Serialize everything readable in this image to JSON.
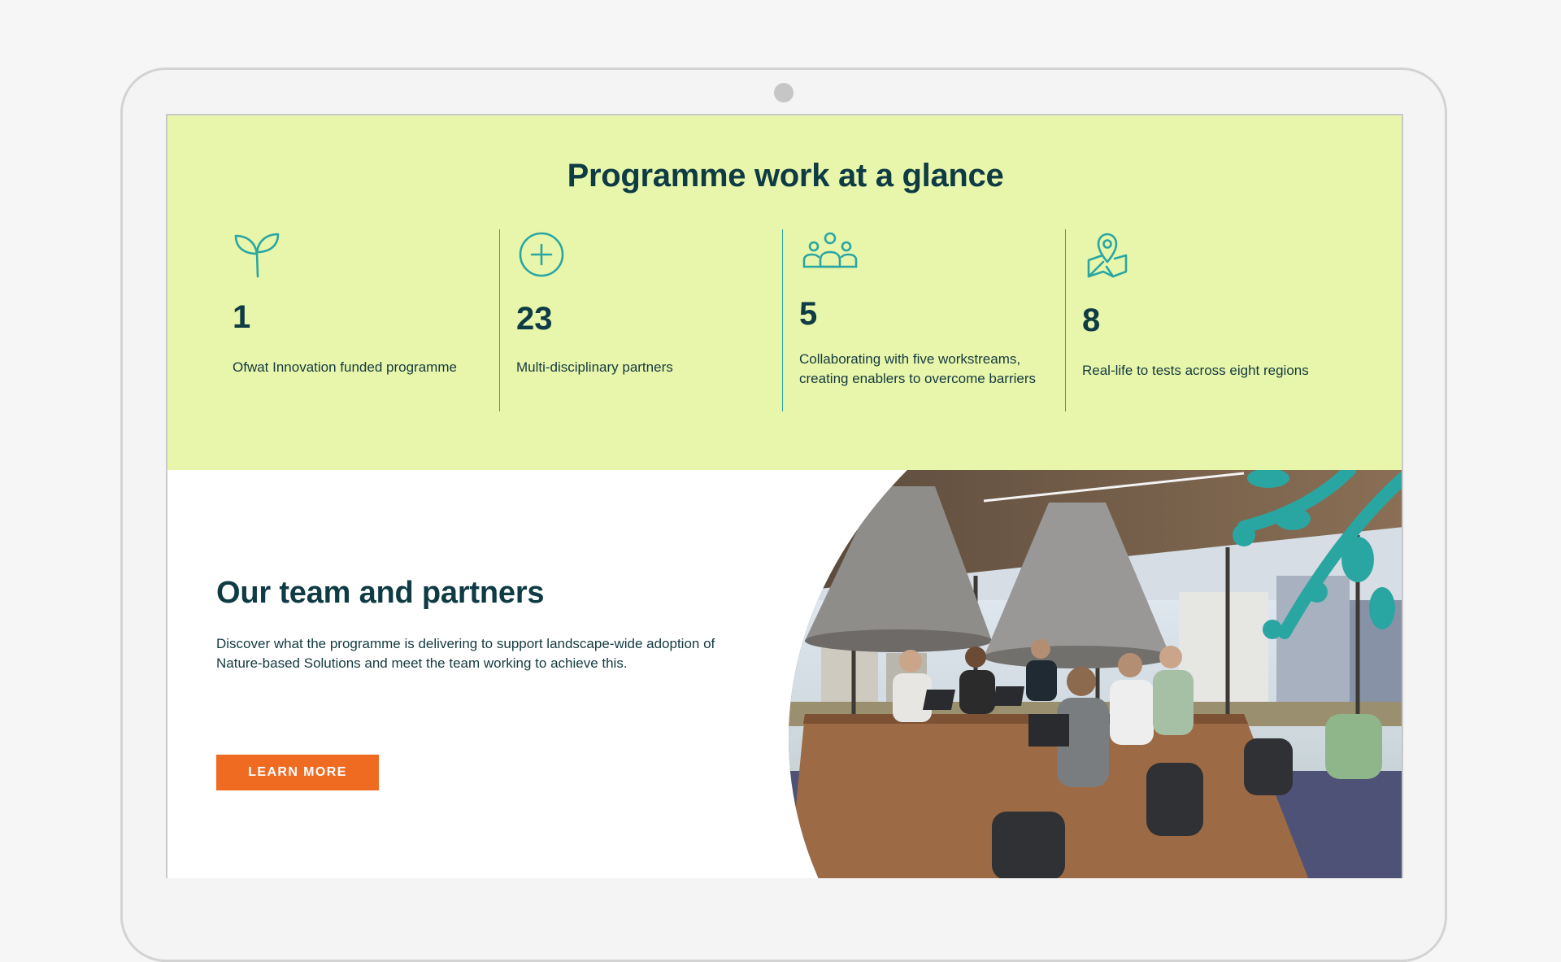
{
  "glance": {
    "title": "Programme work at a glance",
    "stats": [
      {
        "icon": "sprout-icon",
        "value": "1",
        "label": "Ofwat Innovation funded programme"
      },
      {
        "icon": "plus-circle-icon",
        "value": "23",
        "label": "Multi-disciplinary partners"
      },
      {
        "icon": "people-group-icon",
        "value": "5",
        "label": "Collaborating with five workstreams, creating enablers to overcome barriers"
      },
      {
        "icon": "map-pin-icon",
        "value": "8",
        "label": "Real-life to tests across eight regions"
      }
    ]
  },
  "team": {
    "title": "Our team and partners",
    "description": "Discover what the programme is delivering to support landscape-wide adoption of Nature-based Solutions and meet the team working to achieve this.",
    "button_label": "LEARN MORE",
    "photo_alt": "team-meeting-photo"
  },
  "colors": {
    "glance_background": "#e8f6ab",
    "heading": "#0e3b44",
    "accent_teal": "#2aa6a2",
    "button_orange": "#f06b22",
    "device_frame": "#d3d3d3"
  }
}
